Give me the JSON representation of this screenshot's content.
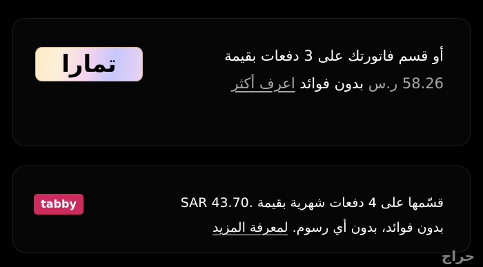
{
  "tamara": {
    "logo_text": "تمارا",
    "line1": "أو قسم فاتورتك على 3 دفعات بقيمة",
    "amount": "58.26 ر.س",
    "no_fees": "بدون فوائد",
    "learn_more": "اعرف أكثر"
  },
  "tabby": {
    "logo_text": "tabby",
    "line1_prefix": "قسّمها على 4 دفعات شهرية بقيمة",
    "amount": "SAR 43.70.",
    "line2": "بدون فوائد، بدون أي رسوم.",
    "learn_more": "لمعرفة المزيد"
  },
  "watermark": "حراج"
}
